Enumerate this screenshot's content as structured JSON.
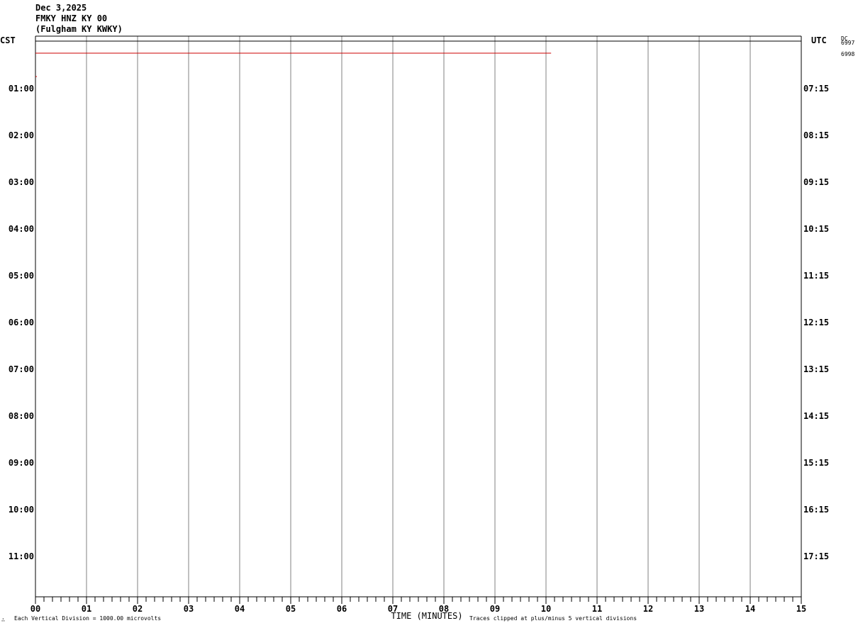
{
  "header": {
    "date": "Dec 3,2025",
    "station": "FMKY HNZ KY 00",
    "location": "(Fulgham KY KWKY)"
  },
  "left_zone_label": "CST",
  "right_zone_label": "UTC",
  "corner_labels": [
    "DC",
    "6997",
    "6998"
  ],
  "footer": {
    "scale_note": "Each Vertical Division = 1000.00 microvolts",
    "clip_note": "Traces clipped at plus/minus 5 vertical divisions",
    "corner_mark": "∴"
  },
  "colors": {
    "grid": "#808080",
    "trace": "#cc0000",
    "border": "#000000"
  },
  "chart_data": {
    "type": "line",
    "title": "",
    "xlabel": "TIME (MINUTES)",
    "ylabel": "",
    "xlim": [
      0,
      15
    ],
    "x_ticks": [
      "00",
      "01",
      "02",
      "03",
      "04",
      "05",
      "06",
      "07",
      "08",
      "09",
      "10",
      "11",
      "12",
      "13",
      "14",
      "15"
    ],
    "left_hour_labels": [
      "01:00",
      "02:00",
      "03:00",
      "04:00",
      "05:00",
      "06:00",
      "07:00",
      "08:00",
      "09:00",
      "10:00",
      "11:00"
    ],
    "right_hour_labels": [
      "07:15",
      "08:15",
      "09:15",
      "10:15",
      "11:15",
      "12:15",
      "13:15",
      "14:15",
      "15:15",
      "16:15",
      "17:15"
    ],
    "grid": true,
    "series": [
      {
        "row": 0,
        "x": [
          0,
          10.1
        ],
        "y": [
          0,
          0
        ]
      }
    ]
  }
}
